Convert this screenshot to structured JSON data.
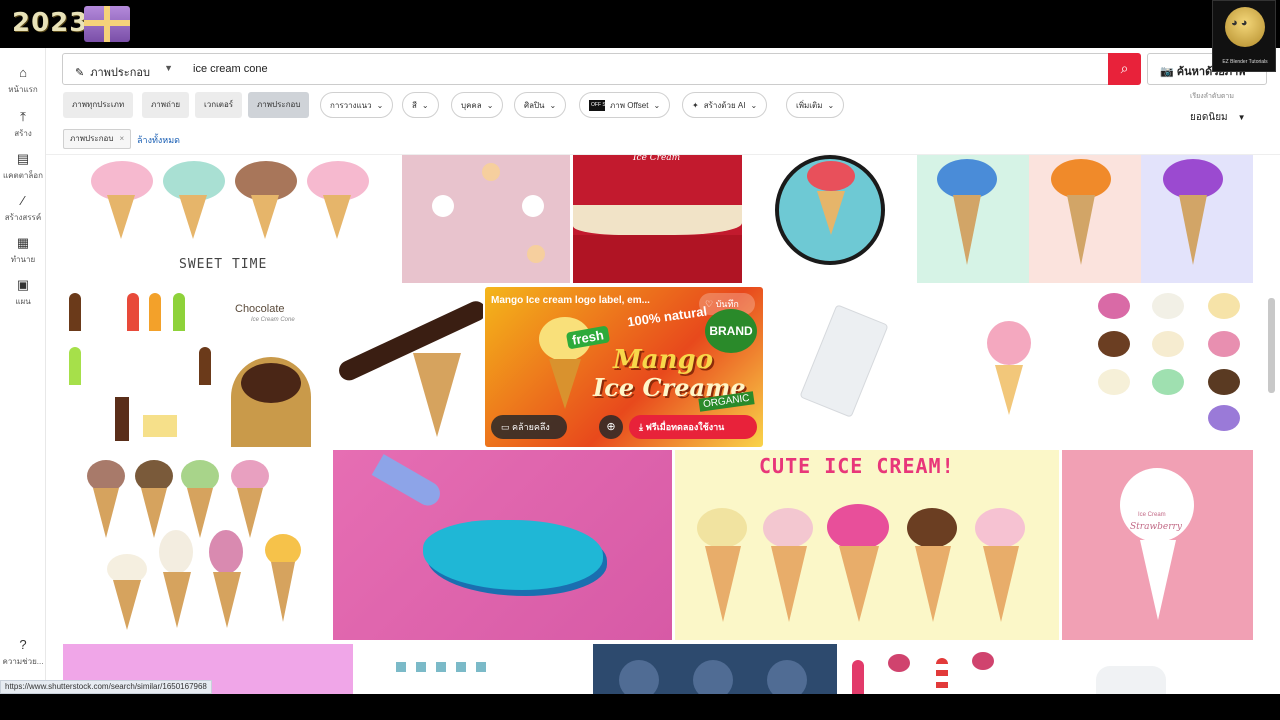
{
  "overlay": {
    "year_badge": "2023",
    "channel_caption": "EZ Blender Tutorials"
  },
  "sidebar": {
    "items": [
      {
        "label": "หน้าแรก",
        "icon": "home-icon"
      },
      {
        "label": "สร้าง",
        "icon": "upload-icon"
      },
      {
        "label": "แคตตาล็อก",
        "icon": "catalog-icon"
      },
      {
        "label": "สร้างสรรค์",
        "icon": "magic-wand-icon"
      },
      {
        "label": "ทำนาย",
        "icon": "grid-icon"
      },
      {
        "label": "แผน",
        "icon": "calendar-icon"
      }
    ],
    "help_label": "ความช่วย..."
  },
  "search": {
    "type_label": "ภาพประกอบ",
    "query": "ice cream cone",
    "image_search_label": "ค้นหาด้วยภาพ"
  },
  "filters": {
    "type_chips": [
      "ภาพทุกประเภท",
      "ภาพถ่าย",
      "เวกเตอร์",
      "ภาพประกอบ"
    ],
    "selected_type": "ภาพประกอบ",
    "dropdowns": [
      "การวางแนว",
      "สี",
      "บุคคล",
      "ศิลปิน",
      "ภาพ Offset",
      "สร้างด้วย AI",
      "เพิ่มเติม"
    ],
    "offset_badge": "OFF SET",
    "sort_label": "เรียงลำดับตาม",
    "sort_value": "ยอดนิยม"
  },
  "active_filters": {
    "tag": "ภาพประกอบ",
    "clear_all": "ล้างทั้งหมด"
  },
  "hover_card": {
    "title": "Mango Ice cream logo label, em...",
    "save_label": "บันทึก",
    "collect_label": "คล้ายคลึง",
    "download_label": "ฟรีเมื่อทดลองใช้งาน",
    "art_line1": "Mango",
    "art_line2": "Ice Creame",
    "art_fresh": "fresh",
    "art_natural": "100% natural",
    "art_brand": "BRAND",
    "art_organic": "ORGANIC"
  },
  "tiles": {
    "sweet_time": "SWEET TIME",
    "chocolate": "Chocolate",
    "chocolate_sub": "Ice Cream Cone",
    "ice_cream_red": "Ice Cream",
    "cute_ice_cream": "CUTE ICE CREAM!",
    "strawberry": "Strawberry",
    "strawberry_sub": "Ice Cream"
  },
  "status_url": "https://www.shutterstock.com/search/similar/1650167968"
}
